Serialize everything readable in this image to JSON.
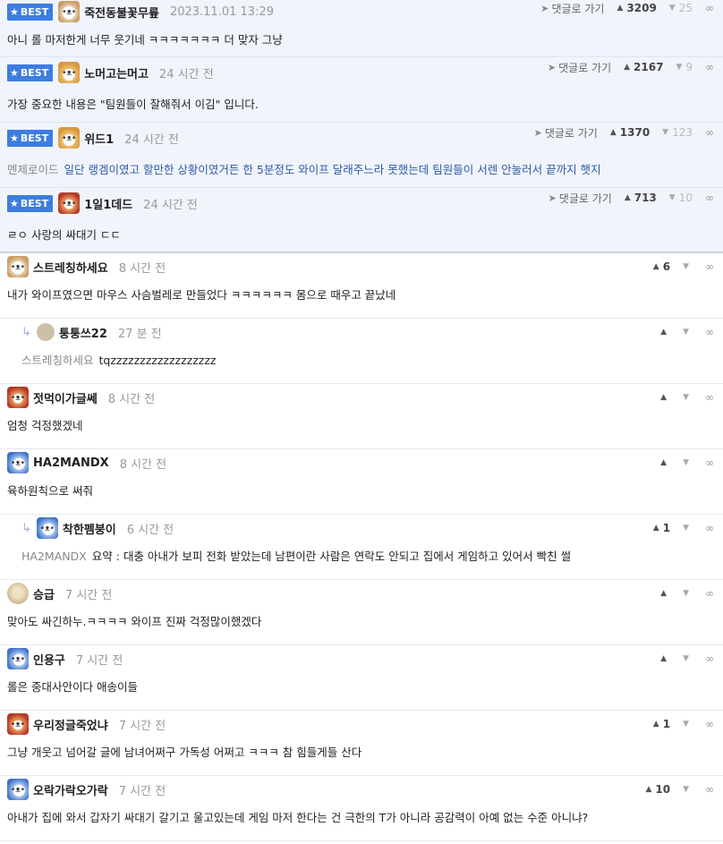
{
  "ui": {
    "best_badge": "BEST",
    "reply_link": "댓글로 가기"
  },
  "comments": [
    {
      "type": "best",
      "avatar": "dog",
      "nick": "죽전동불꽃무륲",
      "time": "2023.11.01 13:29",
      "likes": "3209",
      "dislikes": "25",
      "body": "아니 롤 마저한게 너무 웃기네 ㅋㅋㅋㅋㅋㅋㅋ 더 맞자 그냥",
      "mention": ""
    },
    {
      "type": "best",
      "avatar": "fox",
      "nick": "노머고는머고",
      "time": "24 시간 전",
      "likes": "2167",
      "dislikes": "9",
      "body": "가장 중요한 내용은 \"팀원들이 잘해줘서 이김\" 입니다.",
      "mention": ""
    },
    {
      "type": "best",
      "avatar": "fox",
      "nick": "위드1",
      "time": "24 시간 전",
      "likes": "1370",
      "dislikes": "123",
      "body": "일단 랭겜이였고 할만한 상황이였거든 한 5분정도 와이프 달래주느라 못했는데 팀원들이 서렌 안눌러서 끝까지 햇지",
      "mention": "멘제로이드",
      "blue": true
    },
    {
      "type": "best",
      "avatar": "red",
      "nick": "1일1데드",
      "time": "24 시간 전",
      "likes": "713",
      "dislikes": "10",
      "body": "ㄹㅇ 사랑의 싸대기 ㄷㄷ",
      "mention": ""
    },
    {
      "type": "normal",
      "avatar": "dog",
      "nick": "스트레칭하세요",
      "time": "8 시간 전",
      "likes": "6",
      "body": "내가 와이프였으면 마우스 사슴벌레로 만들었다 ㅋㅋㅋㅋㅋㅋ 몸으로 때우고 끝났네",
      "mention": ""
    },
    {
      "type": "reply",
      "avatar": "small",
      "nick": "퉁퉁쓰22",
      "time": "27 분 전",
      "likes": "",
      "body": "tqzzzzzzzzzzzzzzzzzz",
      "mention": "스트레칭하세요"
    },
    {
      "type": "normal",
      "avatar": "red",
      "nick": "젓먹이가글쎄",
      "time": "8 시간 전",
      "likes": "",
      "body": "엄청 걱정했겠네",
      "mention": ""
    },
    {
      "type": "normal",
      "avatar": "blue",
      "nick": "HA2MANDX",
      "time": "8 시간 전",
      "likes": "",
      "body": "육하원칙으로 써줘",
      "mention": ""
    },
    {
      "type": "reply",
      "avatar": "blue",
      "nick": "착한펨붕이",
      "time": "6 시간 전",
      "likes": "1",
      "body": "요약 : 대충 아내가 보피 전화 받았는데 남편이란 사람은 연락도 안되고 집에서 게임하고 있어서 빡친 썰",
      "mention": "HA2MANDX"
    },
    {
      "type": "normal",
      "avatar": "stone",
      "nick": "승급",
      "time": "7 시간 전",
      "likes": "",
      "body": "맞아도 싸긴하누.ㅋㅋㅋㅋ 와이프 진짜 걱정많이했겠다",
      "mention": ""
    },
    {
      "type": "normal",
      "avatar": "blue",
      "nick": "인용구",
      "time": "7 시간 전",
      "likes": "",
      "body": "롤은 중대사안이다 애송이들",
      "mention": ""
    },
    {
      "type": "normal",
      "avatar": "red",
      "nick": "우리정글죽었냐",
      "time": "7 시간 전",
      "likes": "1",
      "body": "그냥 개웃고 넘어갈 글에 남녀어쩌구 가독성 어쩌고 ㅋㅋㅋ 참 힘들게들 산다",
      "mention": ""
    },
    {
      "type": "normal",
      "avatar": "blue",
      "nick": "오락가락오가락",
      "time": "7 시간 전",
      "likes": "10",
      "body": "아내가 집에 와서 갑자기 싸대기 갈기고 울고있는데 게임 마저 한다는 건 극한의 T가 아니라 공감력이 아예 없는 수준 아니냐?",
      "mention": ""
    }
  ]
}
